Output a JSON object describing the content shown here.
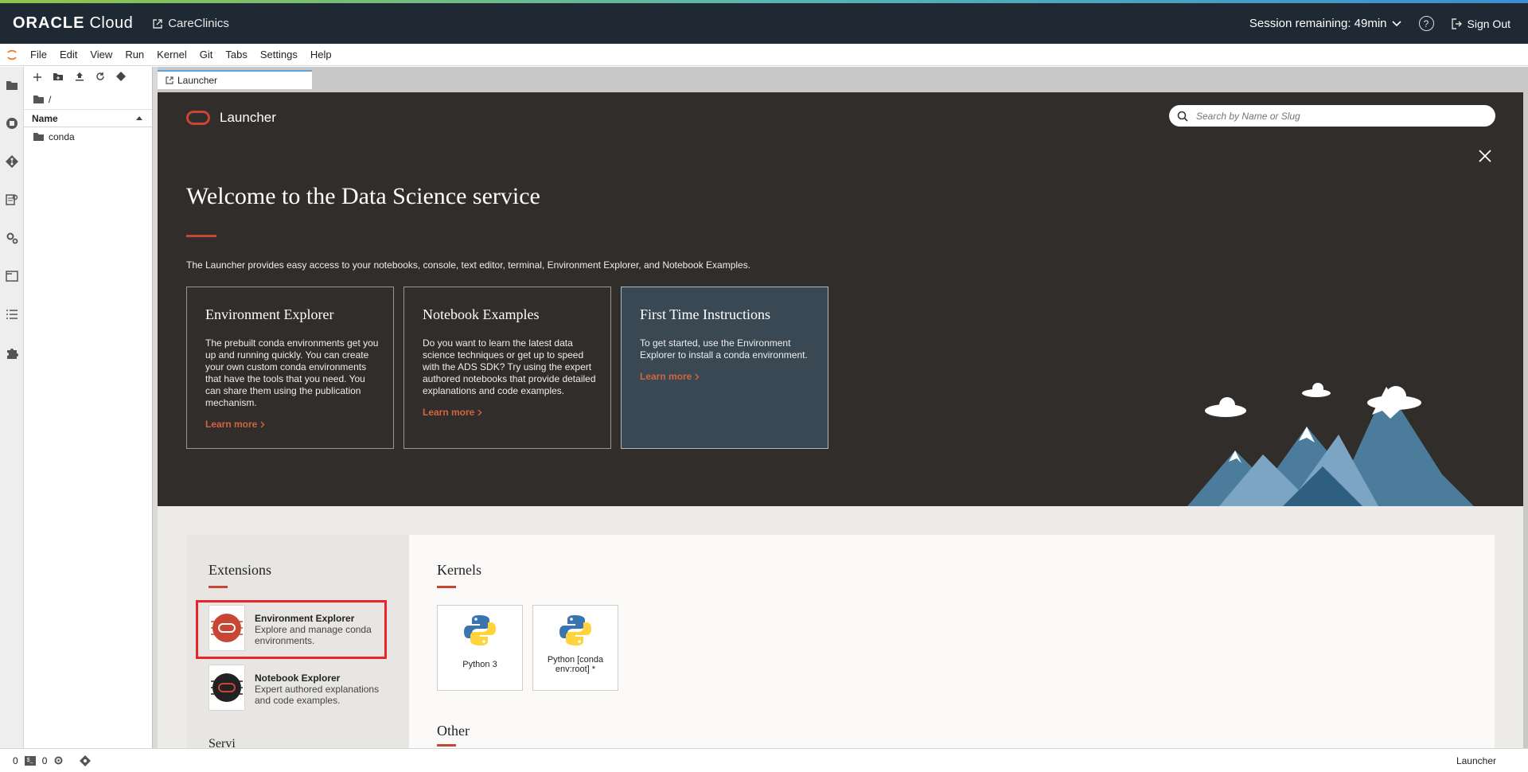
{
  "header": {
    "brand_name": "ORACLE",
    "brand_suffix": "Cloud",
    "tenant_link": "CareClinics",
    "session_label": "Session remaining: 49min",
    "help_label": "?",
    "sign_out": "Sign Out"
  },
  "menubar": {
    "items": [
      "File",
      "Edit",
      "View",
      "Run",
      "Kernel",
      "Git",
      "Tabs",
      "Settings",
      "Help"
    ]
  },
  "filebrowser": {
    "path": "/",
    "column_name": "Name",
    "items": [
      {
        "name": "conda",
        "type": "folder"
      }
    ]
  },
  "tabs": [
    {
      "label": "Launcher",
      "active": true
    }
  ],
  "launcher": {
    "title": "Launcher",
    "search_placeholder": "Search by Name or Slug",
    "welcome_title": "Welcome to the Data Science service",
    "welcome_desc": "The Launcher provides easy access to your notebooks, console, text editor, terminal, Environment Explorer, and Notebook Examples.",
    "cards": [
      {
        "title": "Environment Explorer",
        "body": "The prebuilt conda environments get you up and running quickly. You can create your own custom conda environments that have the tools that you need. You can share them using the publication mechanism.",
        "link": "Learn more"
      },
      {
        "title": "Notebook Examples",
        "body": "Do you want to learn the latest data science techniques or get up to speed with the ADS SDK? Try using the expert authored notebooks that provide detailed explanations and code examples.",
        "link": "Learn more"
      },
      {
        "title": "First Time Instructions",
        "body": "To get started, use the Environment Explorer to install a conda environment.",
        "link": "Learn more"
      }
    ],
    "extensions": {
      "title": "Extensions",
      "items": [
        {
          "title": "Environment Explorer",
          "desc": "Explore and manage conda environments."
        },
        {
          "title": "Notebook Explorer",
          "desc": "Expert authored explanations and code examples."
        }
      ],
      "next_section_partial": "Servi"
    },
    "kernels": {
      "title": "Kernels",
      "items": [
        {
          "label": "Python 3"
        },
        {
          "label": "Python [conda env:root] *"
        }
      ]
    },
    "other_title": "Other"
  },
  "statusbar": {
    "count_a": "0",
    "count_b": "0",
    "right_label": "Launcher"
  },
  "colors": {
    "header_bg": "#1f2933",
    "hero_bg": "#312d2a",
    "accent": "#c74634",
    "link": "#d2643f",
    "highlight": "#e8252a"
  }
}
